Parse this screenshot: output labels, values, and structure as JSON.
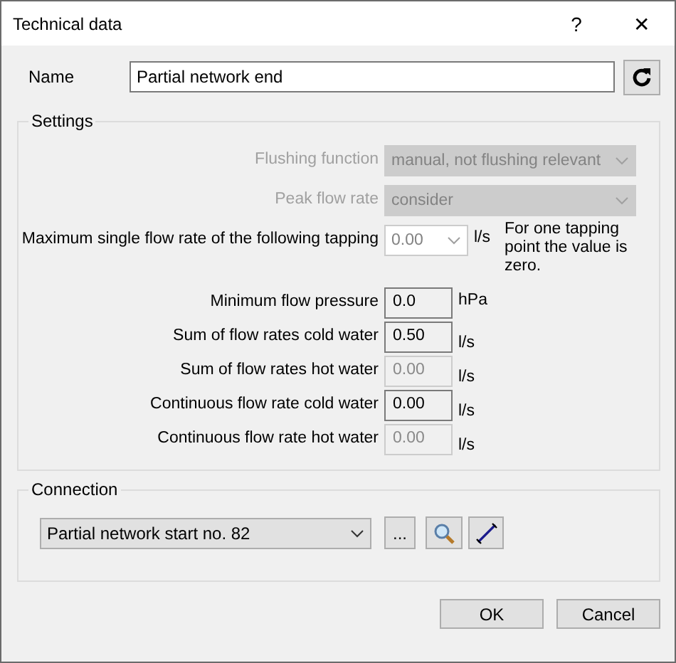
{
  "window": {
    "title": "Technical data",
    "help": "?",
    "close": "✕"
  },
  "name": {
    "label": "Name",
    "value": "Partial network end"
  },
  "settings": {
    "title": "Settings",
    "rows": [
      {
        "kind": "select",
        "label": "Flushing function",
        "label_greyed": true,
        "value": "manual, not flushing relevant",
        "disabled": true
      },
      {
        "kind": "select",
        "label": "Peak flow rate",
        "label_greyed": true,
        "value": "consider",
        "disabled": true
      },
      {
        "kind": "short_select",
        "label": "Maximum single flow rate of the following tapping",
        "label_greyed": false,
        "value": "0.00",
        "disabled": true,
        "unit": "l/s",
        "note": "For one tapping point the value is zero."
      },
      {
        "kind": "input",
        "label": "Minimum flow pressure",
        "label_greyed": false,
        "value": "0.0",
        "disabled": false,
        "unit": "hPa"
      },
      {
        "kind": "input",
        "label": "Sum of flow rates cold water",
        "label_greyed": false,
        "value": "0.50",
        "disabled": false,
        "unit": "l/s"
      },
      {
        "kind": "input",
        "label": "Sum of flow rates hot water",
        "label_greyed": false,
        "value": "0.00",
        "disabled": true,
        "unit": "l/s"
      },
      {
        "kind": "input",
        "label": "Continuous flow rate cold water",
        "label_greyed": false,
        "value": "0.00",
        "disabled": false,
        "unit": "l/s"
      },
      {
        "kind": "input",
        "label": "Continuous flow rate hot water",
        "label_greyed": false,
        "value": "0.00",
        "disabled": true,
        "unit": "l/s"
      }
    ]
  },
  "connection": {
    "title": "Connection",
    "value": "Partial network start no. 82",
    "more": "..."
  },
  "buttons": [
    "OK",
    "Cancel"
  ]
}
